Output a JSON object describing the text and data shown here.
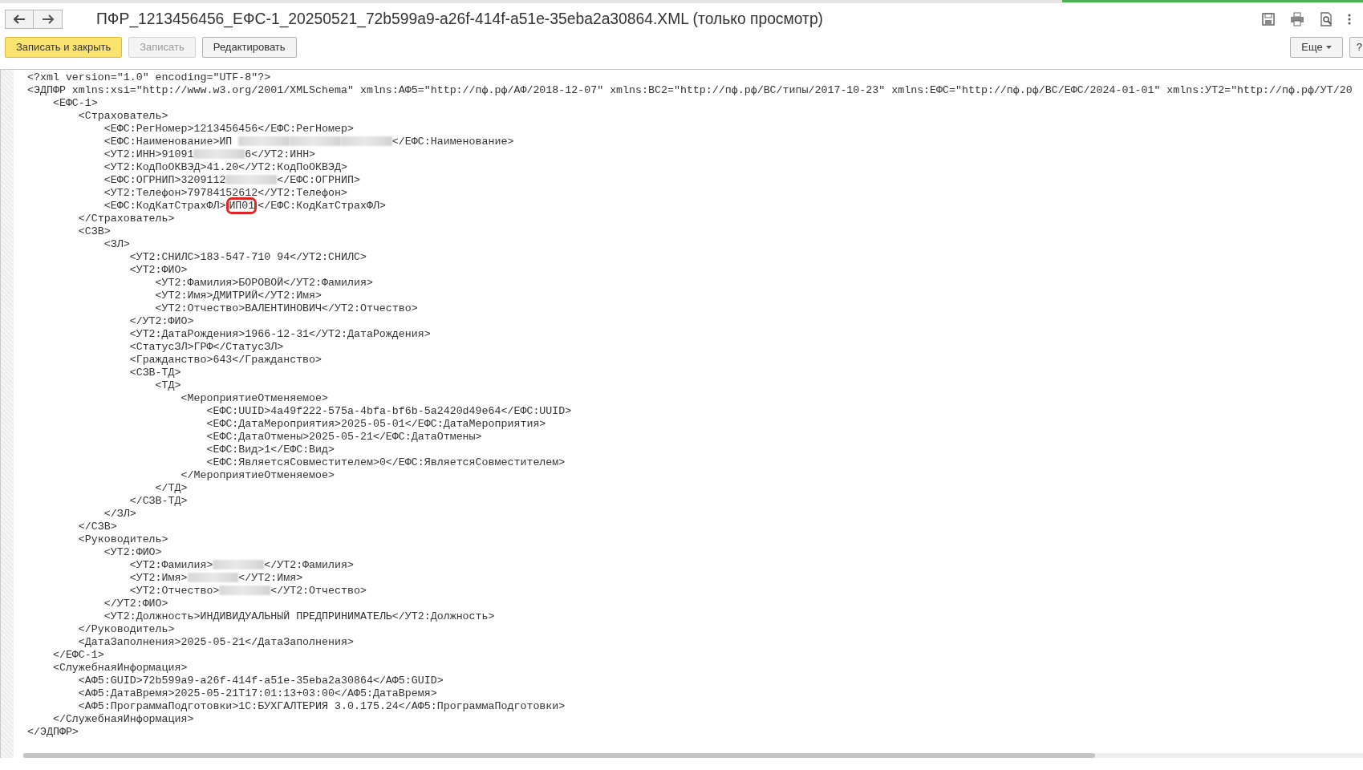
{
  "window": {
    "title": "ПФР_1213456456_ЕФС-1_20250521_72b599a9-a26f-414f-a51e-35eba2a30864.XML (только просмотр)"
  },
  "toolbar": {
    "buttons": [
      {
        "label": "Записать и закрыть",
        "kind": "primary",
        "disabled": false
      },
      {
        "label": "Записать",
        "kind": "default",
        "disabled": true
      },
      {
        "label": "Редактировать",
        "kind": "default",
        "disabled": false
      }
    ],
    "more": {
      "label": "Еще"
    },
    "help": {
      "label": "?"
    }
  },
  "xml": [
    {
      "line": "<?xml version=\"1.0\" encoding=\"UTF-8\"?>"
    },
    {
      "line": "<ЭДПФР xmlns:xsi=\"http://www.w3.org/2001/XMLSchema\" xmlns:АФ5=\"http://пф.рф/АФ/2018-12-07\" xmlns:ВС2=\"http://пф.рф/ВС/типы/2017-10-23\" xmlns:ЕФС=\"http://пф.рф/ВС/ЕФС/2024-01-01\" xmlns:УТ2=\"http://пф.рф/УТ/20",
      "close": "</ЭДПФР>",
      "children": [
        {
          "line": "<ЕФС-1>",
          "close": "</ЕФС-1>",
          "children": [
            {
              "line": "<Страхователь>",
              "close": "</Страхователь>",
              "children": [
                {
                  "line": "<ЕФС:РегНомер>1213456456</ЕФС:РегНомер>"
                },
                {
                  "parts": [
                    {
                      "kind": "text",
                      "text": "<ЕФС:Наименование>ИП "
                    },
                    {
                      "kind": "redacted"
                    },
                    {
                      "kind": "redacted"
                    },
                    {
                      "kind": "redacted"
                    },
                    {
                      "kind": "text",
                      "text": "</ЕФС:Наименование>"
                    }
                  ]
                },
                {
                  "parts": [
                    {
                      "kind": "text",
                      "text": "<УТ2:ИНН>91091"
                    },
                    {
                      "kind": "redacted"
                    },
                    {
                      "kind": "text",
                      "text": "6</УТ2:ИНН>"
                    }
                  ]
                },
                {
                  "line": "<УТ2:КодПоОКВЭД>41.20</УТ2:КодПоОКВЭД>"
                },
                {
                  "parts": [
                    {
                      "kind": "text",
                      "text": "<ЕФС:ОГРНИП>3209112"
                    },
                    {
                      "kind": "redacted"
                    },
                    {
                      "kind": "text",
                      "text": "</ЕФС:ОГРНИП>"
                    }
                  ]
                },
                {
                  "line": "<УТ2:Телефон>79784152612</УТ2:Телефон>"
                },
                {
                  "parts": [
                    {
                      "kind": "text",
                      "text": "<ЕФС:КодКатСтрахФЛ>"
                    },
                    {
                      "kind": "highlight",
                      "text": "ИП01"
                    },
                    {
                      "kind": "text",
                      "text": "</ЕФС:КодКатСтрахФЛ>"
                    }
                  ]
                }
              ]
            },
            {
              "line": "<СЗВ>",
              "close": "</СЗВ>",
              "children": [
                {
                  "line": "<ЗЛ>",
                  "close": "</ЗЛ>",
                  "children": [
                    {
                      "line": "<УТ2:СНИЛС>183-547-710 94</УТ2:СНИЛС>"
                    },
                    {
                      "line": "<УТ2:ФИО>",
                      "close": "</УТ2:ФИО>",
                      "children": [
                        {
                          "line": "<УТ2:Фамилия>БОРОВОЙ</УТ2:Фамилия>"
                        },
                        {
                          "line": "<УТ2:Имя>ДМИТРИЙ</УТ2:Имя>"
                        },
                        {
                          "line": "<УТ2:Отчество>ВАЛЕНТИНОВИЧ</УТ2:Отчество>"
                        }
                      ]
                    },
                    {
                      "line": "<УТ2:ДатаРождения>1966-12-31</УТ2:ДатаРождения>"
                    },
                    {
                      "line": "<СтатусЗЛ>ГРФ</СтатусЗЛ>"
                    },
                    {
                      "line": "<Гражданство>643</Гражданство>"
                    },
                    {
                      "line": "<СЗВ-ТД>",
                      "close": "</СЗВ-ТД>",
                      "children": [
                        {
                          "line": "<ТД>",
                          "close": "</ТД>",
                          "children": [
                            {
                              "line": "<МероприятиеОтменяемое>",
                              "close": "</МероприятиеОтменяемое>",
                              "children": [
                                {
                                  "line": "<ЕФС:UUID>4a49f222-575a-4bfa-bf6b-5a2420d49e64</ЕФС:UUID>"
                                },
                                {
                                  "line": "<ЕФС:ДатаМероприятия>2025-05-01</ЕФС:ДатаМероприятия>"
                                },
                                {
                                  "line": "<ЕФС:ДатаОтмены>2025-05-21</ЕФС:ДатаОтмены>"
                                },
                                {
                                  "line": "<ЕФС:Вид>1</ЕФС:Вид>"
                                },
                                {
                                  "line": "<ЕФС:ЯвляетсяСовместителем>0</ЕФС:ЯвляетсяСовместителем>"
                                }
                              ]
                            }
                          ]
                        }
                      ]
                    }
                  ]
                }
              ]
            },
            {
              "line": "<Руководитель>",
              "close": "</Руководитель>",
              "children": [
                {
                  "line": "<УТ2:ФИО>",
                  "close": "</УТ2:ФИО>",
                  "children": [
                    {
                      "parts": [
                        {
                          "kind": "text",
                          "text": "<УТ2:Фамилия>"
                        },
                        {
                          "kind": "redacted"
                        },
                        {
                          "kind": "text",
                          "text": "</УТ2:Фамилия>"
                        }
                      ]
                    },
                    {
                      "parts": [
                        {
                          "kind": "text",
                          "text": "<УТ2:Имя>"
                        },
                        {
                          "kind": "redacted"
                        },
                        {
                          "kind": "text",
                          "text": "</УТ2:Имя>"
                        }
                      ]
                    },
                    {
                      "parts": [
                        {
                          "kind": "text",
                          "text": "<УТ2:Отчество>"
                        },
                        {
                          "kind": "redacted"
                        },
                        {
                          "kind": "text",
                          "text": "</УТ2:Отчество>"
                        }
                      ]
                    }
                  ]
                },
                {
                  "line": "<УТ2:Должность>ИНДИВИДУАЛЬНЫЙ ПРЕДПРИНИМАТЕЛЬ</УТ2:Должность>"
                }
              ]
            },
            {
              "line": "<ДатаЗаполнения>2025-05-21</ДатаЗаполнения>"
            }
          ]
        },
        {
          "line": "<СлужебнаяИнформация>",
          "close": "</СлужебнаяИнформация>",
          "children": [
            {
              "line": "<АФ5:GUID>72b599a9-a26f-414f-a51e-35eba2a30864</АФ5:GUID>"
            },
            {
              "line": "<АФ5:ДатаВремя>2025-05-21T17:01:13+03:00</АФ5:ДатаВремя>"
            },
            {
              "line": "<АФ5:ПрограммаПодготовки>1С:БУХГАЛТЕРИЯ 3.0.175.24</АФ5:ПрограммаПодготовки>"
            }
          ]
        }
      ]
    }
  ]
}
